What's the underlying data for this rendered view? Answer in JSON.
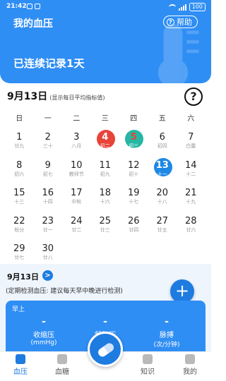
{
  "status_bar": {
    "time": "21:42",
    "battery": "100"
  },
  "header": {
    "title": "我的血压",
    "help_label": "帮助",
    "help_glyph": "?",
    "streak": "已连续记录1天"
  },
  "date_header": {
    "title": "9月13日",
    "note": "(显示每日平均指标值)",
    "help_glyph": "?"
  },
  "weekdays": [
    "日",
    "一",
    "二",
    "三",
    "四",
    "五",
    "六"
  ],
  "calendar": {
    "rows": [
      [
        {
          "d": "1",
          "l": "廿九"
        },
        {
          "d": "2",
          "l": "三十"
        },
        {
          "d": "3",
          "l": "八月"
        },
        {
          "d": "4",
          "l": "初二"
        },
        {
          "d": "5",
          "l": "初三"
        },
        {
          "d": "6",
          "l": "初四"
        },
        {
          "d": "7",
          "l": "白露"
        }
      ],
      [
        {
          "d": "8",
          "l": "初六"
        },
        {
          "d": "9",
          "l": "初七"
        },
        {
          "d": "10",
          "l": "教师节"
        },
        {
          "d": "11",
          "l": "初九"
        },
        {
          "d": "12",
          "l": "初十"
        },
        {
          "d": "13",
          "l": "十一"
        },
        {
          "d": "14",
          "l": "十二"
        }
      ],
      [
        {
          "d": "15",
          "l": "十三"
        },
        {
          "d": "16",
          "l": "十四"
        },
        {
          "d": "17",
          "l": "中秋"
        },
        {
          "d": "18",
          "l": "十六"
        },
        {
          "d": "19",
          "l": "十七"
        },
        {
          "d": "20",
          "l": "十八"
        },
        {
          "d": "21",
          "l": "十九"
        }
      ],
      [
        {
          "d": "22",
          "l": "秋分"
        },
        {
          "d": "23",
          "l": "廿一"
        },
        {
          "d": "24",
          "l": "廿二"
        },
        {
          "d": "25",
          "l": "廿三"
        },
        {
          "d": "26",
          "l": "廿四"
        },
        {
          "d": "27",
          "l": "廿五"
        },
        {
          "d": "28",
          "l": "廿六"
        }
      ],
      [
        {
          "d": "29",
          "l": "廿七"
        },
        {
          "d": "30",
          "l": "廿八"
        }
      ]
    ],
    "marked": {
      "4": "red",
      "5": "teal",
      "13": "blue"
    }
  },
  "panel": {
    "date": "9月13日",
    "chevron": ">",
    "hint": "(定期检测血压: 建议每天早中晚进行检测)",
    "add_glyph": "+",
    "reading": {
      "period": "早上",
      "metrics": [
        {
          "value": "-",
          "label": "收缩压",
          "unit": "(mmHg)"
        },
        {
          "value": "-",
          "label": "舒张压",
          "unit": ""
        },
        {
          "value": "-",
          "label": "脉搏",
          "unit": "(次/分钟)"
        }
      ]
    }
  },
  "tabs": [
    {
      "label": "血压",
      "icon": "blood-pressure-icon",
      "active": true
    },
    {
      "label": "血糖",
      "icon": "blood-sugar-icon",
      "active": false
    },
    {
      "label": "知识",
      "icon": "book-icon",
      "active": false
    },
    {
      "label": "我的",
      "icon": "person-icon",
      "active": false
    }
  ],
  "colors": {
    "primary": "#2f8ef4",
    "accent_blue": "#1e7be0",
    "mark_red": "#e8443a",
    "mark_teal": "#25b7a3"
  }
}
